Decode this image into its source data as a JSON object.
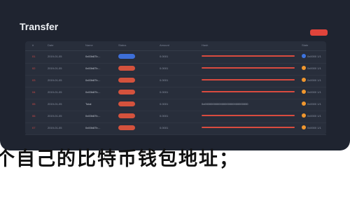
{
  "window": {
    "title": "Transfer",
    "action_label": ""
  },
  "table": {
    "columns": [
      "#",
      "Date",
      "Name",
      "Status",
      "Amount",
      "Hash",
      "State"
    ],
    "rows": [
      {
        "idx": "01",
        "date": "2019-01-05",
        "name": "0x00b87b…",
        "pill": "blue",
        "amount": "0.0001",
        "note": "",
        "bar": true,
        "dot": "blue",
        "state": "0x0000 1/1"
      },
      {
        "idx": "02",
        "date": "2019-01-05",
        "name": "0x00b87b…",
        "pill": "red",
        "amount": "0.0001",
        "note": "",
        "bar": true,
        "dot": "orange",
        "state": "0x0000 1/1"
      },
      {
        "idx": "03",
        "date": "2019-01-05",
        "name": "0x00b87b…",
        "pill": "red",
        "amount": "0.0001",
        "note": "",
        "bar": true,
        "dot": "orange",
        "state": "0x0000 1/1"
      },
      {
        "idx": "04",
        "date": "2019-01-05",
        "name": "0x00b87b…",
        "pill": "red",
        "amount": "0.0001",
        "note": "",
        "bar": true,
        "dot": "orange",
        "state": "0x0000 1/1"
      },
      {
        "idx": "05",
        "date": "2019-01-05",
        "name": "Total",
        "pill": "red",
        "amount": "0.0001",
        "note": "0x0000000000000000000000000000",
        "bar": false,
        "dot": "orange",
        "state": "0x0000 1/1"
      },
      {
        "idx": "06",
        "date": "2019-01-05",
        "name": "0x00b87b…",
        "pill": "red",
        "amount": "0.0001",
        "note": "",
        "bar": true,
        "dot": "orange",
        "state": "0x0000 1/1"
      },
      {
        "idx": "07",
        "date": "2019-01-05",
        "name": "0x00b87b…",
        "pill": "red",
        "amount": "0.0001",
        "note": "",
        "bar": true,
        "dot": "orange",
        "state": "0x0000 1/1"
      }
    ]
  },
  "caption": "个自己的比特币钱包地址；"
}
